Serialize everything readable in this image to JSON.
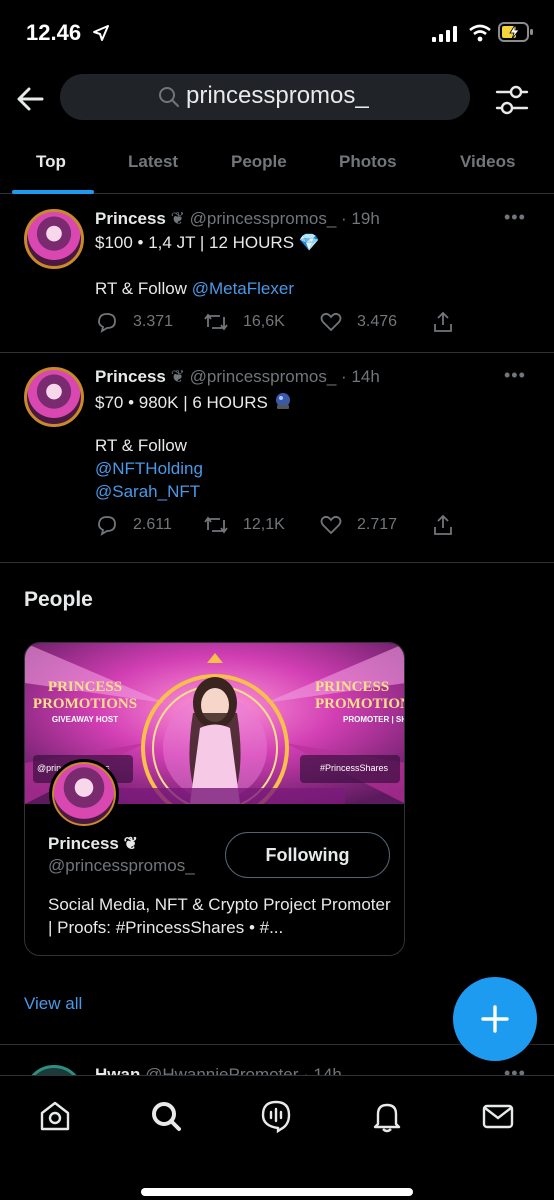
{
  "status_bar": {
    "time": "12.46"
  },
  "search": {
    "query": "princesspromos_"
  },
  "tabs": [
    {
      "label": "Top"
    },
    {
      "label": "Latest"
    },
    {
      "label": "People"
    },
    {
      "label": "Photos"
    },
    {
      "label": "Videos"
    }
  ],
  "tweets": [
    {
      "name": "Princess",
      "badge": "❦",
      "handle": "@princesspromos_ · 19h",
      "line1": "$100 • 1,4 JT | 12 HOURS",
      "line1_emoji": "💎",
      "line2": "RT & Follow",
      "mention1": "@MetaFlexer",
      "replies": "3.371",
      "retweets": "16,6K",
      "likes": "3.476"
    },
    {
      "name": "Princess",
      "badge": "❦",
      "handle": "@princesspromos_ · 14h",
      "line1": "$70 • 980K | 6 HOURS",
      "line2": "RT & Follow",
      "mention1": "@NFTHolding",
      "mention2": "@Sarah_NFT",
      "replies": "2.611",
      "retweets": "12,1K",
      "likes": "2.717"
    }
  ],
  "people": {
    "title": "People",
    "card": {
      "banner_left_title": "PRINCESS PROMOTIONS",
      "banner_left_sub": "GIVEAWAY HOST",
      "banner_left_handle": "@princesspromos",
      "banner_right_title": "PRINCESS PROMOTIONS",
      "banner_right_sub": "PROMOTER | SHIL",
      "banner_right_tag": "#PrincessShares",
      "name": "Princess",
      "badge": "❦",
      "handle": "@princesspromos_",
      "follow_label": "Following",
      "bio": "Social Media, NFT & Crypto Project Promoter | Proofs: #PrincessShares • #..."
    },
    "view_all": "View all"
  },
  "peek_tweet": {
    "name": "Hwan",
    "handle": "@HwanniePromoter · 14h"
  },
  "colors": {
    "accent": "#1d9bf0",
    "link": "#4a99e9",
    "muted": "#71767b",
    "background": "#000000"
  }
}
